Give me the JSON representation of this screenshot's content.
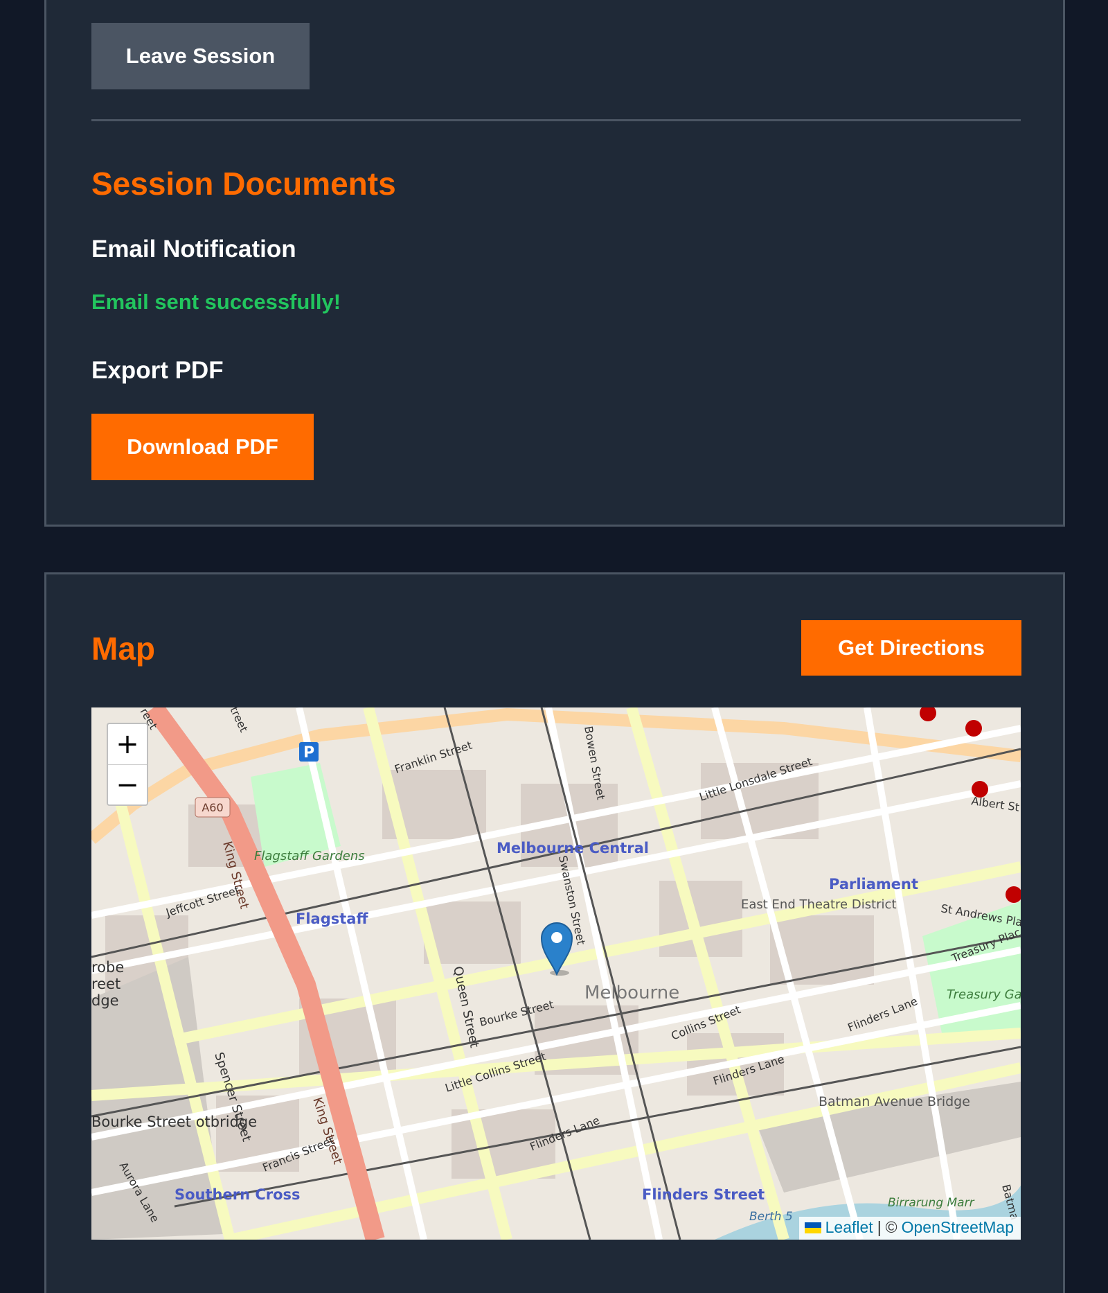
{
  "session": {
    "leave_label": "Leave Session",
    "documents_title": "Session Documents",
    "email_heading": "Email Notification",
    "email_status": "Email sent successfully!",
    "export_heading": "Export PDF",
    "download_label": "Download PDF"
  },
  "map_section": {
    "title": "Map",
    "directions_label": "Get Directions",
    "zoom_in": "+",
    "zoom_out": "−",
    "attribution": {
      "leaflet": "Leaflet",
      "separator": "|",
      "copyright": "©",
      "osm": "OpenStreetMap"
    },
    "road_badge": "A60",
    "labels": {
      "franklin": "Franklin Street",
      "bowen": "Bowen Street",
      "little_lonsdale": "Little Lonsdale Street",
      "albert": "Albert St",
      "king_n": "King Street",
      "flagstaff_gardens": "Flagstaff Gardens",
      "melbourne_central": "Melbourne Central",
      "swanston": "Swanston Street",
      "parliament": "Parliament",
      "east_end": "East End Theatre District",
      "st_andrews": "St Andrews Plac",
      "jeffcott": "Jeffcott Street",
      "flagstaff": "Flagstaff",
      "treasury_place": "Treasury Plac",
      "treasury_gardens": "Treasury Gardens",
      "robe": "robe",
      "reet": "reet",
      "dge": "dge",
      "melbourne": "Melbourne",
      "queen": "Queen Street",
      "bourke": "Bourke Street",
      "collins": "Collins Street",
      "flinders_lane_e": "Flinders Lane",
      "little_collins": "Little Collins Street",
      "flinders_lane_mid": "Flinders Lane",
      "flinders_lane_w": "Flinders Lane",
      "spencer": "Spencer Street",
      "king_s": "King Street",
      "batman": "Batman Avenue Bridge",
      "bourke_footbridge": "Bourke Street otbridge",
      "francis": "Francis Street",
      "aurora": "Aurora Lane",
      "southern_cross": "Southern Cross",
      "flinders_street": "Flinders Street",
      "berth": "Berth 5",
      "birrarung": "Birrarung Marr",
      "batma": "Batma",
      "eet_top": "reet",
      "street_top": "treet"
    }
  },
  "colors": {
    "accent": "#ff6b00",
    "success": "#22c55e",
    "card_bg": "#1f2937",
    "page_bg": "#111827",
    "border": "#4b5563"
  }
}
